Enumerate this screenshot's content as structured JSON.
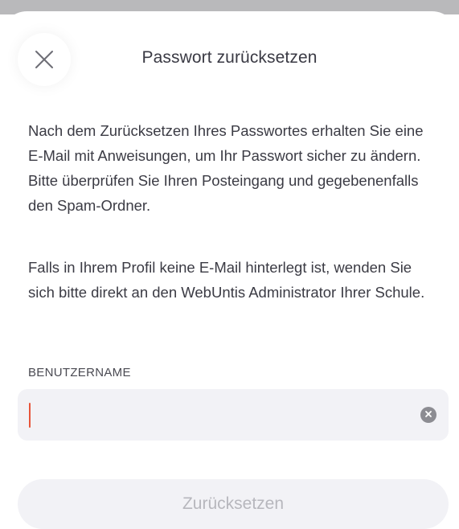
{
  "dialog": {
    "title": "Passwort zurücksetzen",
    "close_icon": "close-icon"
  },
  "content": {
    "paragraph1": "Nach dem Zurücksetzen Ihres Passwortes erhalten Sie eine E-Mail mit Anweisungen, um Ihr Passwort sicher zu ändern. Bitte überprüfen Sie Ihren Posteingang und gegebenenfalls den Spam-Ordner.",
    "paragraph2": "Falls in Ihrem Profil keine E-Mail hinterlegt ist, wenden Sie sich bitte direkt an den WebUntis Administrator Ihrer Schule."
  },
  "form": {
    "username_label": "BENUTZERNAME",
    "username_value": "",
    "clear_icon": "clear-circle-icon",
    "submit_label": "Zurücksetzen",
    "submit_enabled": false
  },
  "colors": {
    "accent_caret": "#e8553a",
    "text": "#3b3b44",
    "field_background": "#f2f2f6",
    "disabled_text": "#b7b7bd"
  }
}
